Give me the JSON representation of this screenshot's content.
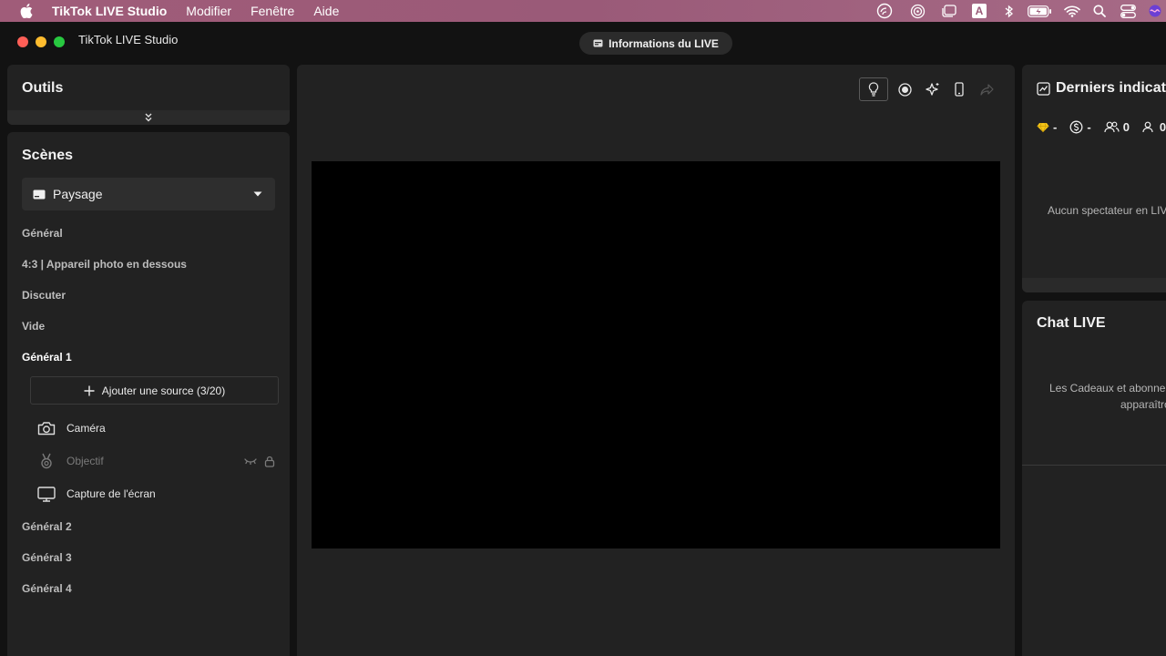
{
  "menubar": {
    "app_name": "TikTok LIVE Studio",
    "items": [
      "Modifier",
      "Fenêtre",
      "Aide"
    ],
    "status_icons": [
      "screen-time-icon",
      "airdrop-icon",
      "stage-manager-icon",
      "input-source-icon",
      "bluetooth-icon",
      "battery-icon",
      "wifi-icon",
      "spotlight-icon",
      "control-center-icon",
      "siri-icon"
    ],
    "input_source_letter": "A"
  },
  "window": {
    "title": "TikTok LIVE Studio",
    "live_info_label": "Informations du LIVE"
  },
  "tools": {
    "title": "Outils"
  },
  "scenes": {
    "title": "Scènes",
    "selected_layout": "Paysage",
    "items": [
      "Général",
      "4:3 | Appareil photo en dessous",
      "Discuter",
      "Vide",
      "Général 1",
      "Général 2",
      "Général 3",
      "Général 4"
    ],
    "active_item": "Général 1",
    "add_source_label": "Ajouter une source (3/20)",
    "sources": [
      {
        "label": "Caméra",
        "icon": "camera-icon",
        "enabled": true
      },
      {
        "label": "Objectif",
        "icon": "medal-icon",
        "enabled": false
      },
      {
        "label": "Capture de l'écran",
        "icon": "monitor-icon",
        "enabled": true
      }
    ]
  },
  "preview": {
    "toolbar_icons": [
      "lightbulb-icon",
      "record-icon",
      "sparkle-icon",
      "phone-icon",
      "share-icon"
    ]
  },
  "metrics": {
    "title": "Derniers indicateurs",
    "values": {
      "diamonds": "-",
      "coins": "-",
      "viewers": "0",
      "followers": "0"
    },
    "empty_text": "Aucun spectateur en LIVE"
  },
  "chat": {
    "title": "Chat LIVE",
    "line1": "Les Cadeaux et abonnements",
    "line2": "apparaîtront ici"
  },
  "colors": {
    "background": "#121212",
    "panel": "#222222",
    "menubar": "#9a5a78",
    "traffic_red": "#ff5f57",
    "traffic_yellow": "#febc2e",
    "traffic_green": "#28c840"
  }
}
